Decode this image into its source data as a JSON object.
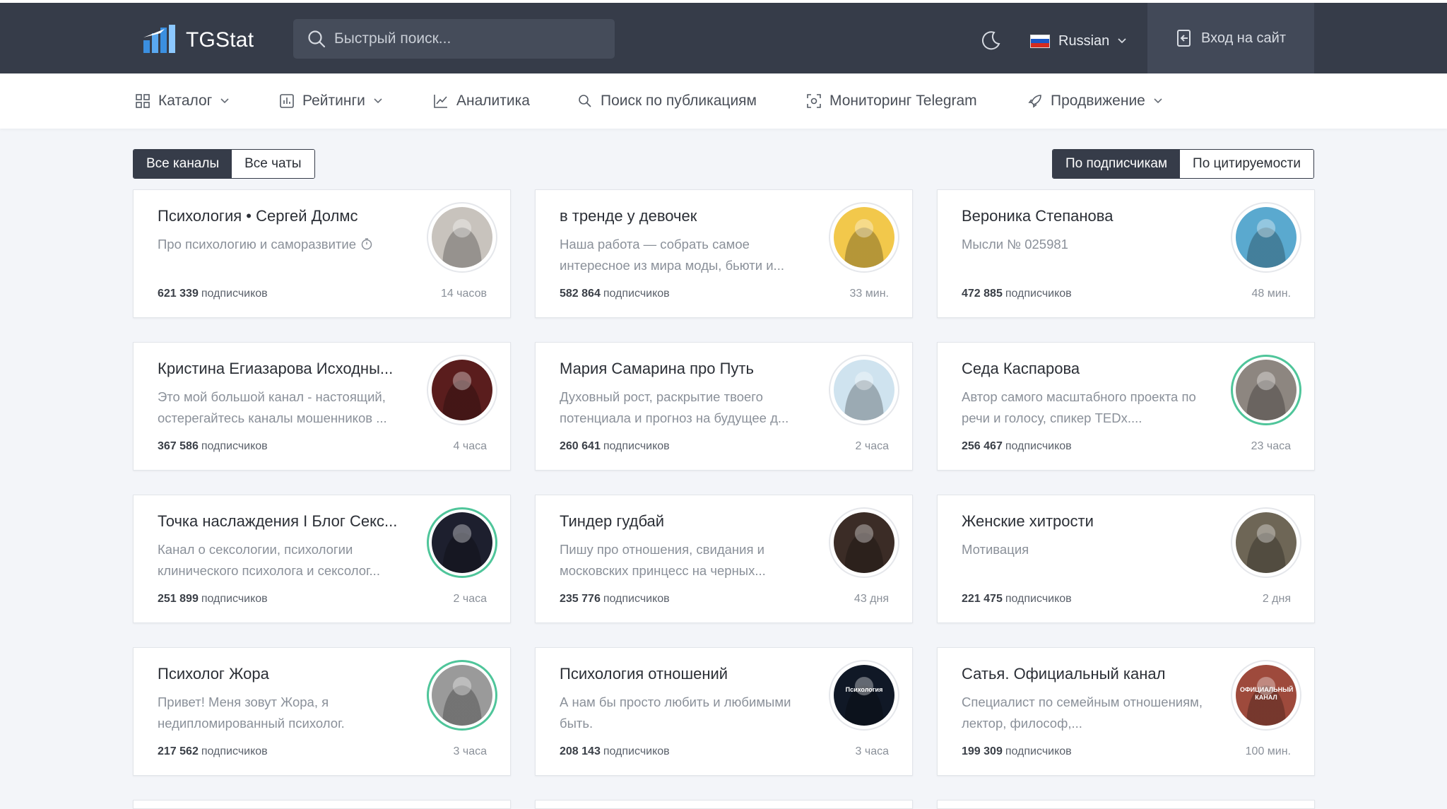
{
  "header": {
    "logo_text": "TGStat",
    "search_placeholder": "Быстрый поиск...",
    "language": "Russian",
    "login_label": "Вход на сайт"
  },
  "nav": {
    "items": [
      {
        "label": "Каталог",
        "icon": "grid-icon",
        "dropdown": true
      },
      {
        "label": "Рейтинги",
        "icon": "bar-chart-icon",
        "dropdown": true
      },
      {
        "label": "Аналитика",
        "icon": "line-chart-icon",
        "dropdown": false
      },
      {
        "label": "Поиск по публикациям",
        "icon": "search-icon",
        "dropdown": false
      },
      {
        "label": "Мониторинг Telegram",
        "icon": "monitor-icon",
        "dropdown": false
      },
      {
        "label": "Продвижение",
        "icon": "rocket-icon",
        "dropdown": true
      }
    ]
  },
  "filters": {
    "left": [
      "Все каналы",
      "Все чаты"
    ],
    "left_active": 0,
    "right": [
      "По подписчикам",
      "По цитируемости"
    ],
    "right_active": 0
  },
  "subs_suffix": "подписчиков",
  "cards": [
    {
      "title": "Психология • Сергей Долмс",
      "desc": "Про психологию и саморазвитие",
      "subs": "621 339",
      "time": "14 часов",
      "ring": false,
      "timer": true,
      "avatar_color": "#c8c3bd"
    },
    {
      "title": "в тренде у девочек",
      "desc": "Наша работа — собрать самое интересное из мира моды, бьюти и...",
      "subs": "582 864",
      "time": "33 мин.",
      "ring": false,
      "timer": false,
      "avatar_color": "#f2c84b"
    },
    {
      "title": "Вероника Степанова",
      "desc": "Мысли № 025981",
      "subs": "472 885",
      "time": "48 мин.",
      "ring": false,
      "timer": false,
      "avatar_color": "#5aa9cf"
    },
    {
      "title": "Кристина Егиазарова Исходны...",
      "desc": "Это мой большой канал - настоящий, остерегайтесь каналы мошенников ...",
      "subs": "367 586",
      "time": "4 часа",
      "ring": false,
      "timer": false,
      "avatar_color": "#5a1d1d"
    },
    {
      "title": "Мария Самарина про Путь",
      "desc": "Духовный рост, раскрытие твоего потенциала и прогноз на будущее д...",
      "subs": "260 641",
      "time": "2 часа",
      "ring": false,
      "timer": false,
      "avatar_color": "#cfe3ef"
    },
    {
      "title": "Седа Каспарова",
      "desc": "Автор самого масштабного проекта по речи и голосу, спикер TEDx....",
      "subs": "256 467",
      "time": "23 часа",
      "ring": true,
      "timer": false,
      "avatar_color": "#8d8680"
    },
    {
      "title": "Точка наслаждения I Блог Секс...",
      "desc": "Канал о сексологии, психологии клинического психолога и сексолог...",
      "subs": "251 899",
      "time": "2 часа",
      "ring": true,
      "timer": false,
      "avatar_color": "#1d1f2e"
    },
    {
      "title": "Тиндер гудбай",
      "desc": "Пишу про отношения, свидания и московских принцесс на черных...",
      "subs": "235 776",
      "time": "43 дня",
      "ring": false,
      "timer": false,
      "avatar_color": "#3b2c26"
    },
    {
      "title": "Женские хитрости",
      "desc": "Мотивация",
      "subs": "221 475",
      "time": "2 дня",
      "ring": false,
      "timer": false,
      "avatar_color": "#6e6656"
    },
    {
      "title": "Психолог Жора",
      "desc": "Привет! Меня зовут Жора, я недипломированный психолог.",
      "subs": "217 562",
      "time": "3 часа",
      "ring": true,
      "timer": false,
      "avatar_color": "#9a9a9a"
    },
    {
      "title": "Психология отношений",
      "desc": "А нам бы просто любить и любимыми быть.",
      "subs": "208 143",
      "time": "3 часа",
      "ring": false,
      "timer": false,
      "avatar_color": "#101826",
      "avatar_text": "Психология"
    },
    {
      "title": "Сатья. Официальный канал",
      "desc": "Специалист по семейным отношениям, лектор, философ,...",
      "subs": "199 309",
      "time": "100 мин.",
      "ring": false,
      "timer": false,
      "avatar_color": "#9e4a3c",
      "avatar_text": "ОФИЦИАЛЬНЫЙ КАНАЛ"
    }
  ],
  "colors": {
    "header_bg": "#363c49",
    "accent_ring": "#4fc59a"
  }
}
